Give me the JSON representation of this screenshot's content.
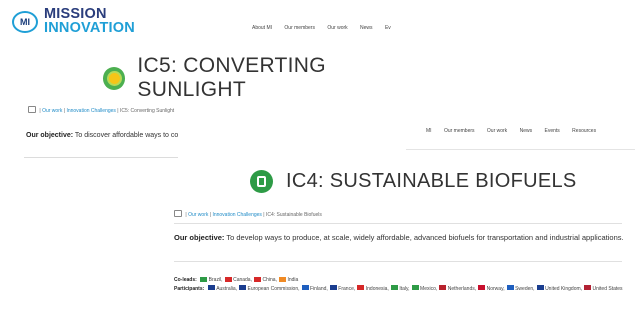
{
  "logo": {
    "mark": "MI",
    "line1": "MISSION",
    "line2": "INNOVATION"
  },
  "nav_back": [
    "About MI",
    "Our members",
    "Our work",
    "News",
    "Ev"
  ],
  "ic5": {
    "title": "IC5: CONVERTING SUNLIGHT",
    "icon": "sunlight-icon",
    "breadcrumb": {
      "sep1": " | ",
      "link1": "Our work",
      "sep2": " | ",
      "link2": "Innovation Challenges",
      "sep3": " | ",
      "current": "IC5: Converting Sunlight"
    },
    "objective_label": "Our objective:",
    "objective_text": " To discover affordable ways to convert sunlight into storable solar fuels."
  },
  "nav_front": [
    "MI",
    "Our members",
    "Our work",
    "News",
    "Events",
    "Resources"
  ],
  "ic4": {
    "title": "IC4: SUSTAINABLE BIOFUELS",
    "icon": "biofuel-pump-icon",
    "breadcrumb": {
      "sep1": " | ",
      "link1": "Our work",
      "sep2": " | ",
      "link2": "Innovation Challenges",
      "sep3": " | ",
      "current": "IC4: Sustainable Biofuels"
    },
    "objective_label": "Our objective:",
    "objective_text": " To develop ways to produce, at scale, widely affordable, advanced biofuels for transportation and industrial applications.",
    "coleads_label": "Co-leads:",
    "coleads": [
      {
        "name": "Brazil",
        "color": "#2e9b46"
      },
      {
        "name": "Canada",
        "color": "#d62828"
      },
      {
        "name": "China",
        "color": "#d62828"
      },
      {
        "name": "India",
        "color": "#f08a24"
      }
    ],
    "participants_label": "Participants:",
    "participants": [
      {
        "name": "Australia",
        "color": "#1a3d8f"
      },
      {
        "name": "European Commission",
        "color": "#1a3d8f"
      },
      {
        "name": "Finland",
        "color": "#1f5fbf"
      },
      {
        "name": "France",
        "color": "#1a3d8f"
      },
      {
        "name": "Indonesia",
        "color": "#d62828"
      },
      {
        "name": "Italy",
        "color": "#2e9b46"
      },
      {
        "name": "Mexico",
        "color": "#2e9b46"
      },
      {
        "name": "Netherlands",
        "color": "#b8222d"
      },
      {
        "name": "Norway",
        "color": "#c8102e"
      },
      {
        "name": "Sweden",
        "color": "#1f5fbf"
      },
      {
        "name": "United Kingdom",
        "color": "#1a3d8f"
      },
      {
        "name": "United States",
        "color": "#b22234"
      }
    ]
  }
}
